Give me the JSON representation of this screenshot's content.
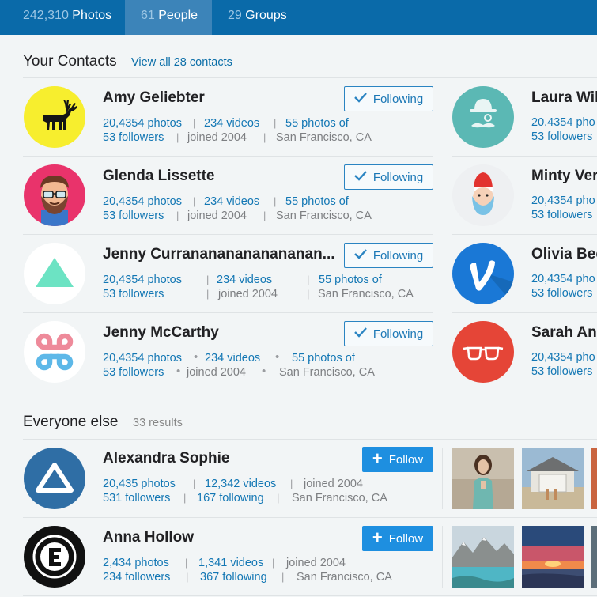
{
  "tabs": [
    {
      "count": "242,310",
      "label": "Photos"
    },
    {
      "count": "61",
      "label": "People"
    },
    {
      "count": "29",
      "label": "Groups"
    }
  ],
  "contacts_section": {
    "title": "Your Contacts",
    "view_all": "View all 28 contacts"
  },
  "contacts_left": [
    {
      "name": "Amy Geliebter",
      "photos": "20,4354 photos",
      "videos": "234 videos",
      "photos_of": "55 photos of",
      "followers": "53 followers",
      "joined": "joined 2004",
      "location": "San Francisco, CA",
      "button": "Following",
      "avatar_icon": "elk-icon"
    },
    {
      "name": "Glenda Lissette",
      "photos": "20,4354 photos",
      "videos": "234 videos",
      "photos_of": "55 photos of",
      "followers": "53 followers",
      "joined": "joined 2004",
      "location": "San Francisco, CA",
      "button": "Following",
      "avatar_icon": "bearded-man-icon"
    },
    {
      "name": "Jenny Curranananananananan...",
      "photos": "20,4354 photos",
      "videos": "234 videos",
      "photos_of": "55 photos of",
      "followers": "53 followers",
      "joined": "joined 2004",
      "location": "San Francisco, CA",
      "button": "Following",
      "avatar_icon": "triangle-icon"
    },
    {
      "name": "Jenny McCarthy",
      "photos": "20,4354 photos",
      "videos": "234 videos",
      "photos_of": "55 photos of",
      "followers": "53 followers",
      "joined": "joined 2004",
      "location": "San Francisco, CA",
      "button": "Following",
      "avatar_icon": "command-key-icon"
    }
  ],
  "contacts_right": [
    {
      "name": "Laura Wil",
      "photos": "20,4354 pho",
      "followers": "53 followers",
      "avatar_icon": "bowler-hat-mustache-icon"
    },
    {
      "name": "Minty Ver",
      "photos": "20,4354 pho",
      "followers": "53 followers",
      "avatar_icon": "sailor-beard-icon"
    },
    {
      "name": "Olivia Bec",
      "photos": "20,4354 pho",
      "followers": "53 followers",
      "avatar_icon": "v-logo-icon"
    },
    {
      "name": "Sarah Anr",
      "photos": "20,4354 pho",
      "followers": "53 followers",
      "avatar_icon": "glasses-icon"
    }
  ],
  "everyone_section": {
    "title": "Everyone else",
    "results": "33 results"
  },
  "everyone": [
    {
      "name": "Alexandra Sophie",
      "photos": "20,435 photos",
      "videos": "12,342 videos",
      "joined": "joined 2004",
      "followers": "531 followers",
      "following": "167 following",
      "location": "San Francisco, CA",
      "button": "Follow",
      "avatar_icon": "triangle-outline-icon"
    },
    {
      "name": "Anna Hollow",
      "photos": "2,434 photos",
      "videos": "1,341 videos",
      "joined": "joined 2004",
      "followers": "234 followers",
      "following": "367 following",
      "location": "San Francisco, CA",
      "button": "Follow",
      "avatar_icon": "letter-e-icon"
    }
  ],
  "colors": {
    "topbar": "#0a6aa9",
    "active_tab": "#3c84b9",
    "link": "#1377b4",
    "follow_button": "#1e8fe0"
  }
}
